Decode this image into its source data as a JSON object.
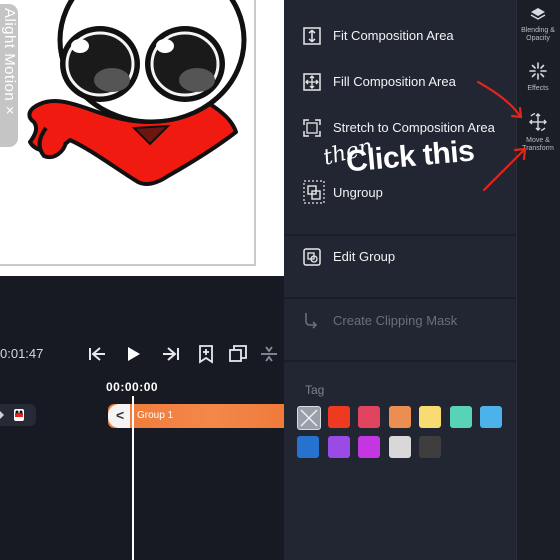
{
  "watermark": {
    "text": "Alight Motion ×"
  },
  "timeline": {
    "timecode": "0:01:47",
    "playhead_time": "00:00:00",
    "clip_name": "Group 1",
    "clip_handle_glyph": "<"
  },
  "menu": {
    "items": [
      {
        "label": "Fit Composition Area",
        "icon": "fit-composition-icon",
        "enabled": true
      },
      {
        "label": "Fill Composition Area",
        "icon": "fill-composition-icon",
        "enabled": true
      },
      {
        "label": "Stretch to Composition Area",
        "icon": "stretch-composition-icon",
        "enabled": true
      },
      {
        "label": "Ungroup",
        "icon": "ungroup-icon",
        "enabled": true
      },
      {
        "label": "Edit Group",
        "icon": "edit-group-icon",
        "enabled": true
      },
      {
        "label": "Create Clipping Mask",
        "icon": "clipping-mask-icon",
        "enabled": false
      }
    ],
    "tag_label": "Tag",
    "tag_colors": [
      "none",
      "#ee3a20",
      "#e0445e",
      "#ec8e52",
      "#f8dc72",
      "#58d3b6",
      "#4eb2ea",
      "#2572cf",
      "#9a4be6",
      "#c437e0",
      "#d8d8d8",
      "#3e3e3e"
    ]
  },
  "rail": {
    "items": [
      {
        "label": "Blending & Opacity",
        "icon": "blending-icon"
      },
      {
        "label": "Effects",
        "icon": "effects-icon"
      },
      {
        "label": "Move & Transform",
        "icon": "move-transform-icon"
      }
    ]
  },
  "annotation": {
    "then_text": "then",
    "click_text": "Click this",
    "arrow_color": "#e3241b"
  },
  "colors": {
    "panel": "#222632",
    "rail": "#1b1e27",
    "clip": "#f07a3a",
    "mascot_scarf": "#f01a10"
  }
}
